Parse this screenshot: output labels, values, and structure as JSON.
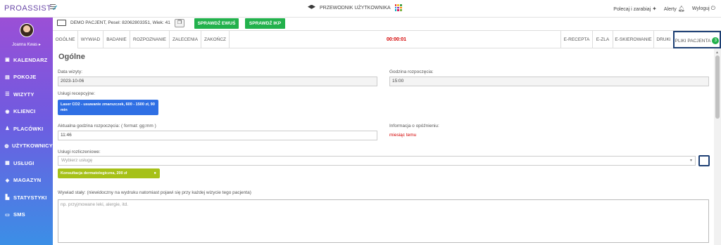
{
  "app": {
    "logo_text": "PROASSIST",
    "guide_label": "PRZEWODNIK UŻYTKOWNIKA",
    "polecaj_label": "Polecaj i zarabiaj",
    "alerty_label": "Alerty",
    "wyloguj_label": "Wyloguj"
  },
  "sidebar": {
    "user_name": "Joanna Kwas",
    "items": [
      {
        "label": "KALENDARZ",
        "icon": "calendar-icon"
      },
      {
        "label": "POKOJE",
        "icon": "rooms-icon"
      },
      {
        "label": "WIZYTY",
        "icon": "list-icon"
      },
      {
        "label": "KLIENCI",
        "icon": "clients-icon"
      },
      {
        "label": "PLACÓWKI",
        "icon": "branches-icon"
      },
      {
        "label": "UŻYTKOWNICY",
        "icon": "user-icon"
      },
      {
        "label": "USŁUGI",
        "icon": "grid-icon"
      },
      {
        "label": "MAGAZYN",
        "icon": "box-icon"
      },
      {
        "label": "STATYSTYKI",
        "icon": "bar-chart-icon"
      },
      {
        "label": "SMS",
        "icon": "message-icon"
      }
    ]
  },
  "patient_bar": {
    "info": "DEMO PACJENT, Pesel: 82062803351, Wiek: 41",
    "ewus_label": "SPRAWDŹ EWUŚ",
    "ikp_label": "SPRAWDŹ IKP"
  },
  "tabs": {
    "left": [
      "OGÓLNE",
      "WYWIAD",
      "BADANIE",
      "ROZPOZNANIE",
      "ZALECENIA",
      "ZAKOŃCZ"
    ],
    "timer": "00:00:01",
    "right": [
      "E-RECEPTA",
      "E-ZLA",
      "E-SKIEROWANIE",
      "DRUKI",
      "PLIKI PACJENTA"
    ],
    "pliki_badge": "3"
  },
  "form": {
    "title": "Ogólne",
    "data_wizyty_label": "Data wizyty:",
    "data_wizyty_value": "2023-10-06",
    "godzina_label": "Godzina rozpoczęcia:",
    "godzina_value": "15:00",
    "uslugi_recepcyjne_label": "Usługi recepcyjne:",
    "usluga_recepcyjna_tag": "Laser CO2 - usuwanie zmarszczek, 600 - 1500 zł, 90 min",
    "aktualna_godzina_label": "Aktualna godzina rozpoczęcia: ( format: gg:mm )",
    "aktualna_godzina_value": "11:46",
    "opoznienie_label": "Informacja o opóźnieniu:",
    "opoznienie_value": "miesiąc temu",
    "uslugi_rozliczeniowe_label": "Usługi rozliczeniowe:",
    "wybierz_placeholder": "Wybierz usługę",
    "usluga_rozliczeniowa_tag": "Konsultacja dermatologiczna, 200 zł",
    "wywiad_staly_label": "Wywiad stały: (niewidoczny na wydruku natomiast pojawi się przy każdej wizycie tego pacjenta)",
    "wywiad_placeholder": "np. przyjmowane leki, alergie, itd."
  }
}
